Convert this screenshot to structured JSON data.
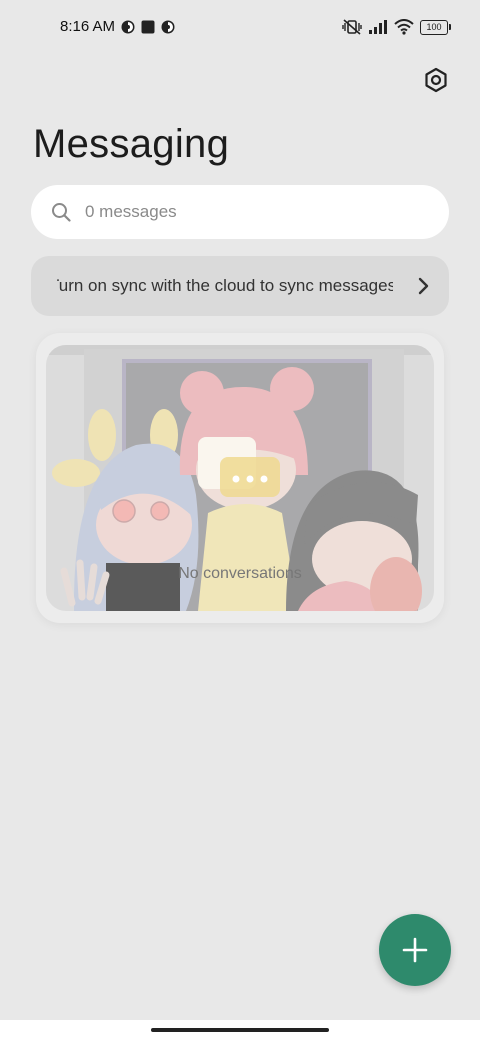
{
  "status_bar": {
    "time": "8:16 AM",
    "battery": "100"
  },
  "header": {
    "title": "Messaging",
    "settings_icon": "gear-icon"
  },
  "search": {
    "placeholder": "0 messages",
    "icon": "search-icon"
  },
  "sync_banner": {
    "text": "Turn on sync with the cloud to sync messages",
    "icon": "chevron-right-icon"
  },
  "empty_state": {
    "text": "No conversations"
  },
  "fab": {
    "icon": "plus-icon",
    "color": "#2e8a6c"
  },
  "colors": {
    "background": "#e8e8e8",
    "accent": "#2e8a6c"
  }
}
